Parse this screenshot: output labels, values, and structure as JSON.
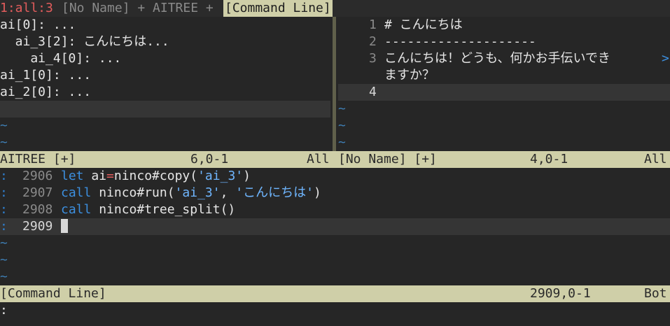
{
  "tabline": {
    "tab1": "1:all:3",
    "tab2": "[No Name] + AITREE +",
    "tab3": "[Command Line]"
  },
  "left_pane": {
    "lines": [
      "ai[0]: ...",
      "  ai_3[2]: こんにちは...",
      "    ai_4[0]: ...",
      "ai_1[0]: ...",
      "ai_2[0]: ...",
      ""
    ],
    "tilde": "~",
    "status": {
      "name": "AITREE [+]",
      "pos": "6,0-1",
      "scroll": "All"
    }
  },
  "right_pane": {
    "lines": [
      {
        "num": "1",
        "text": "# こんにちは"
      },
      {
        "num": "2",
        "text": "--------------------"
      },
      {
        "num": "3",
        "text": "こんにちは！どうも、何かお手伝いでき"
      },
      {
        "num": "",
        "text": "ますか？"
      },
      {
        "num": "4",
        "text": ""
      }
    ],
    "wrap_marker": ">",
    "tilde": "~",
    "status": {
      "name": "[No Name] [+]",
      "pos": "4,0-1",
      "scroll": "All"
    }
  },
  "cmdwin": {
    "prefix": ":",
    "lines": [
      {
        "num": "2906",
        "kw": "let",
        "p1": " ai",
        "op": "=",
        "p2": "ninco#copy(",
        "s1": "'ai_3'",
        "p3": ")",
        "s2": "",
        "p4": ""
      },
      {
        "num": "2907",
        "kw": "call",
        "p1": " ninco#run(",
        "op": "",
        "p2": "",
        "s1": "'ai_3'",
        "p3": ", ",
        "s2": "'こんにちは'",
        "p4": ")"
      },
      {
        "num": "2908",
        "kw": "call",
        "p1": " ninco#tree_split()",
        "op": "",
        "p2": "",
        "s1": "",
        "p3": "",
        "s2": "",
        "p4": ""
      },
      {
        "num": "2909",
        "kw": "",
        "p1": "",
        "op": "",
        "p2": "",
        "s1": "",
        "p3": "",
        "s2": "",
        "p4": ""
      }
    ],
    "tilde": "~",
    "status": {
      "name": "[Command Line]",
      "pos": "2909,0-1",
      "scroll": "Bot"
    }
  },
  "cmdline": {
    "text": ":"
  },
  "colors": {
    "background": "#262626",
    "status_bg": "#cfcfa8",
    "tilde": "#3f7fb5",
    "keyword": "#3c8fdf",
    "string": "#6fb6ff",
    "tab_active": "#e25c5c"
  }
}
